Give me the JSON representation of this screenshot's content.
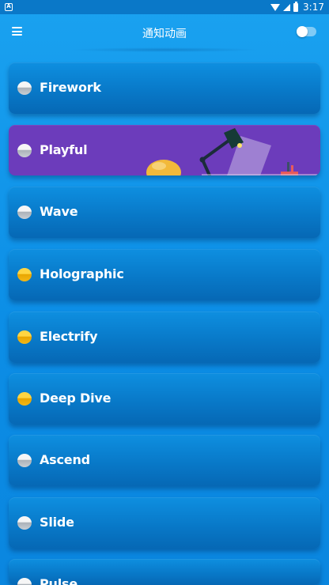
{
  "status_bar": {
    "notification_icon": "A",
    "time": "3:17"
  },
  "app_bar": {
    "title": "通知动画",
    "menu_icon": "hamburger-menu-icon",
    "toggle_on": false
  },
  "animations": [
    {
      "label": "Firework",
      "dot": "silver",
      "selected": false
    },
    {
      "label": "Playful",
      "dot": "silver",
      "selected": true
    },
    {
      "label": "Wave",
      "dot": "silver",
      "selected": false
    },
    {
      "label": "Holographic",
      "dot": "gold",
      "selected": false
    },
    {
      "label": "Electrify",
      "dot": "gold",
      "selected": false
    },
    {
      "label": "Deep Dive",
      "dot": "gold",
      "selected": false
    },
    {
      "label": "Ascend",
      "dot": "silver",
      "selected": false
    },
    {
      "label": "Slide",
      "dot": "silver",
      "selected": false
    },
    {
      "label": "Pulse",
      "dot": "silver",
      "selected": false
    }
  ],
  "colors": {
    "background": "#0c8ee6",
    "card": "#0877c6",
    "selected_card": "#6c3cbb",
    "gold_dot": "#ffd542"
  }
}
